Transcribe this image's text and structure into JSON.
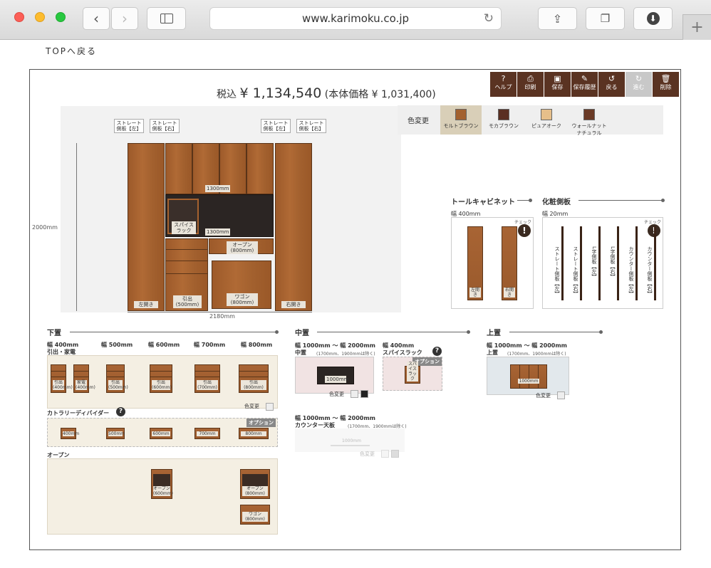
{
  "browser": {
    "url": "www.karimoku.co.jp"
  },
  "top_link": "TOPへ戻る",
  "toolbar": [
    {
      "icon": "help-icon",
      "glyph": "?",
      "label": "ヘルプ"
    },
    {
      "icon": "print-icon",
      "glyph": "⎙",
      "label": "印刷"
    },
    {
      "icon": "save-icon",
      "glyph": "▣",
      "label": "保存"
    },
    {
      "icon": "history-icon",
      "glyph": "✎",
      "label": "保存履歴"
    },
    {
      "icon": "undo-icon",
      "glyph": "↺",
      "label": "戻る"
    },
    {
      "icon": "redo-icon",
      "glyph": "↻",
      "label": "進む"
    },
    {
      "icon": "delete-icon",
      "glyph": "🗑",
      "label": "削除"
    }
  ],
  "price": {
    "tax_in_label": "税込",
    "tax_in": "¥ 1,134,540",
    "base": "(本体価格 ¥ 1,031,400)"
  },
  "color_change": {
    "label": "色変更",
    "options": [
      {
        "name": "モルトブラウン",
        "color": "#a3612f",
        "selected": true
      },
      {
        "name": "モカブラウン",
        "color": "#5a2f22",
        "selected": false
      },
      {
        "name": "ピュアオーク",
        "color": "#e6bf8a",
        "selected": false
      },
      {
        "name": "ウォールナット ナチュラル",
        "color": "#6a3a26",
        "selected": false
      }
    ]
  },
  "drawing": {
    "height": "2000mm",
    "width": "2180mm",
    "top_tags": [
      "ストレート 側板【左】",
      "ストレート 側板【右】",
      "ストレート 側板【左】",
      "ストレート 側板【右】"
    ],
    "labels": {
      "upper": "1300mm",
      "middle": "1300mm",
      "spice": "スパイス ラック",
      "open": "オープン (800mm)",
      "left_open": "左開き",
      "drawer": "引出 (500mm)",
      "wagon": "ワゴン (800mm)",
      "right_open": "右開き"
    }
  },
  "tall_cabinet": {
    "title": "トールキャビネット",
    "width": "幅 400mm",
    "check": "チェック",
    "items": [
      "左開き",
      "右開き"
    ]
  },
  "side_panel": {
    "title": "化粧側板",
    "width": "幅 20mm",
    "check": "チェック",
    "items": [
      "ストレート側板【左】",
      "ストレート側板【右】",
      "L字側板【左】",
      "L字側板【右】",
      "カウンター側板【左】",
      "カウンター側板【右】"
    ]
  },
  "lower": {
    "title": "下置",
    "widths": [
      "幅 400mm",
      "幅 500mm",
      "幅 600mm",
      "幅 700mm",
      "幅 800mm"
    ],
    "drawer_title": "引出・家電",
    "drawers": [
      "引出 (400mm)",
      "家電 (400mm)",
      "引出 (500mm)",
      "引出 (600mm)",
      "引出 (700mm)",
      "引出 (800mm)"
    ],
    "color_change": "色変更",
    "divider_title": "カトラリーディバイダー",
    "option": "オプション",
    "dividers": [
      "400mm",
      "500mm",
      "600mm",
      "700mm",
      "800mm"
    ],
    "open_title": "オープン",
    "opens": [
      "オープン (600mm)",
      "オープン (800mm)",
      "ワゴン (800mm)"
    ]
  },
  "middle": {
    "title": "中置",
    "range": "幅 1000mm 〜 幅 2000mm",
    "sub": "中置",
    "note": "(1700mm、1900mmは除く)",
    "item": "1000mm",
    "color_change": "色変更",
    "spice_width": "幅 400mm",
    "spice_title": "スパイスラック",
    "option": "オプション",
    "spice_item": "スパイス ラック",
    "counter_range": "幅 1000mm 〜 幅 2000mm",
    "counter_title": "カウンター天板",
    "counter_note": "(1700mm、1900mmは除く)",
    "counter_item": "1000mm",
    "counter_color": "色変更"
  },
  "upper": {
    "title": "上置",
    "range": "幅 1000mm 〜 幅 2000mm",
    "sub": "上置",
    "note": "(1700mm、1900mmは除く)",
    "item": "1000mm",
    "color_change": "色変更"
  }
}
